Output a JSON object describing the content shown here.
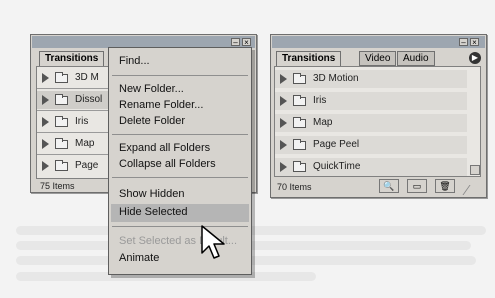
{
  "left_panel": {
    "tab": "Transitions",
    "items": [
      "3D M",
      "Dissol",
      "Iris",
      "Map",
      "Page"
    ],
    "status": "75 Items"
  },
  "menu": {
    "items": [
      {
        "label": "Find...",
        "disabled": false
      },
      {
        "label": "New Folder...",
        "disabled": false
      },
      {
        "label": "Rename Folder...",
        "disabled": false
      },
      {
        "label": "Delete Folder",
        "disabled": false
      },
      {
        "label": "Expand all Folders",
        "disabled": false
      },
      {
        "label": "Collapse all Folders",
        "disabled": false
      },
      {
        "label": "Show Hidden",
        "disabled": false
      },
      {
        "label": "Hide Selected",
        "disabled": false,
        "highlighted": true
      },
      {
        "label": "Set Selected as D...ult...",
        "disabled": true
      },
      {
        "label": "Animate",
        "disabled": false
      }
    ]
  },
  "right_panel": {
    "tabs": [
      "Transitions",
      "Video",
      "Audio"
    ],
    "items": [
      "3D Motion",
      "Iris",
      "Map",
      "Page Peel",
      "QuickTime"
    ],
    "status": "70 Items"
  },
  "icons": {
    "minimize": "minimize-icon",
    "close": "close-icon",
    "folder": "folder-icon",
    "triangle": "expand-triangle-icon",
    "binoculars": "find-icon",
    "new_folder": "new-folder-icon",
    "trash": "trash-icon",
    "cursor": "arrow-cursor-icon"
  }
}
